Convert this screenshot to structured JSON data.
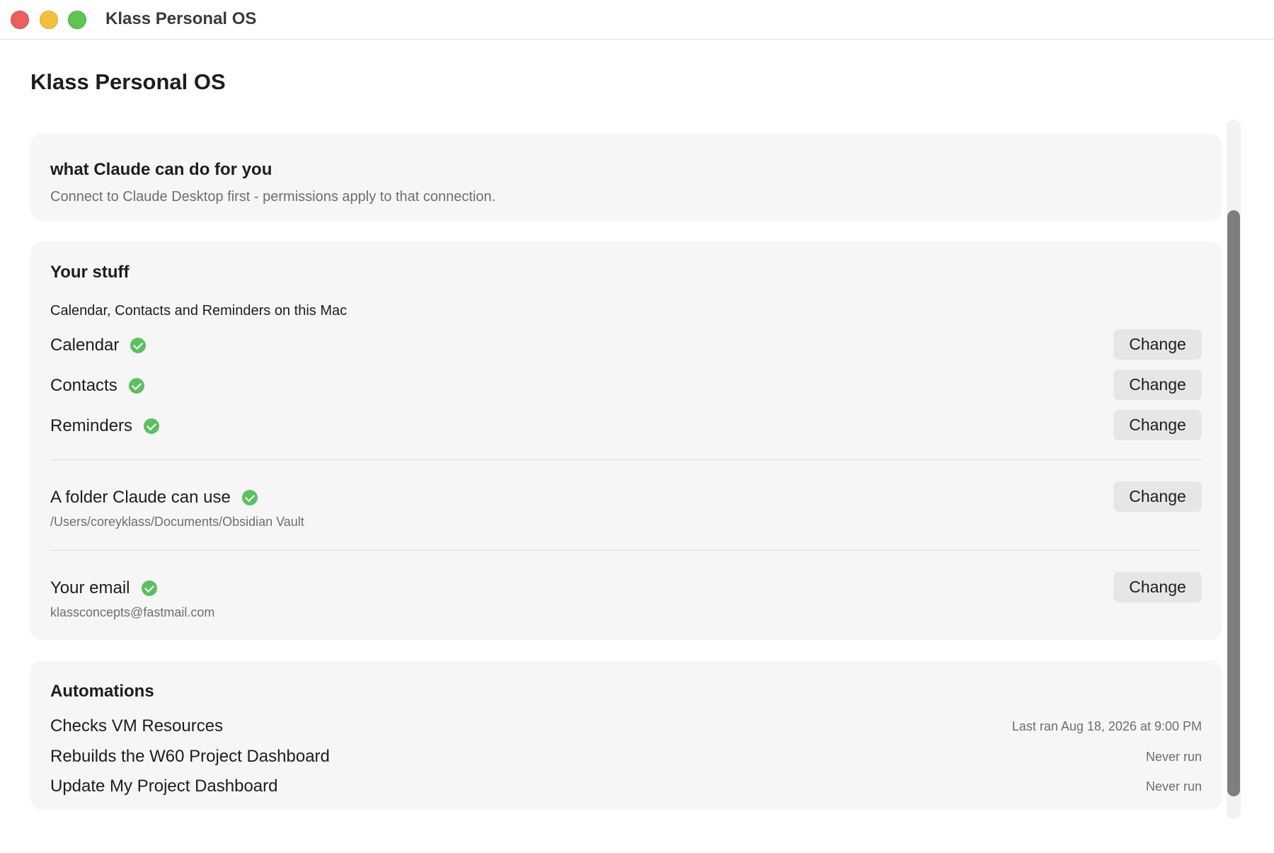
{
  "window": {
    "title": "Klass Personal OS",
    "traffic_lights": {
      "close": "#ec5f5a",
      "minimize": "#f4bf3c",
      "maximize": "#5fc454"
    }
  },
  "page": {
    "title": "Klass Personal OS"
  },
  "intro_card": {
    "title": "what Claude can do for you",
    "subtitle": "Connect to Claude Desktop first - permissions apply to that connection."
  },
  "stuff_card": {
    "title": "Your stuff",
    "subtitle": "Calendar, Contacts and Reminders on this Mac",
    "items": [
      {
        "label": "Calendar",
        "status_icon": "check-circle-icon",
        "button": "Change"
      },
      {
        "label": "Contacts",
        "status_icon": "check-circle-icon",
        "button": "Change"
      },
      {
        "label": "Reminders",
        "status_icon": "check-circle-icon",
        "button": "Change"
      }
    ],
    "folder": {
      "label": "A folder Claude can use",
      "status_icon": "check-circle-icon",
      "path": "/Users/coreyklass/Documents/Obsidian Vault",
      "button": "Change"
    },
    "email": {
      "label": "Your email",
      "status_icon": "check-circle-icon",
      "value": "klassconcepts@fastmail.com",
      "button": "Change"
    }
  },
  "automations_card": {
    "title": "Automations",
    "items": [
      {
        "name": "Checks VM Resources",
        "status": "Last ran Aug 18, 2026 at 9:00 PM"
      },
      {
        "name": "Rebuilds the W60 Project Dashboard",
        "status": "Never run"
      },
      {
        "name": "Update My Project Dashboard",
        "status": "Never run"
      }
    ]
  },
  "colors": {
    "check_green": "#5cbf62",
    "card_background": "#f6f6f6",
    "button_background": "#e6e6e6",
    "scroll_thumb": "#7f7f7f"
  }
}
